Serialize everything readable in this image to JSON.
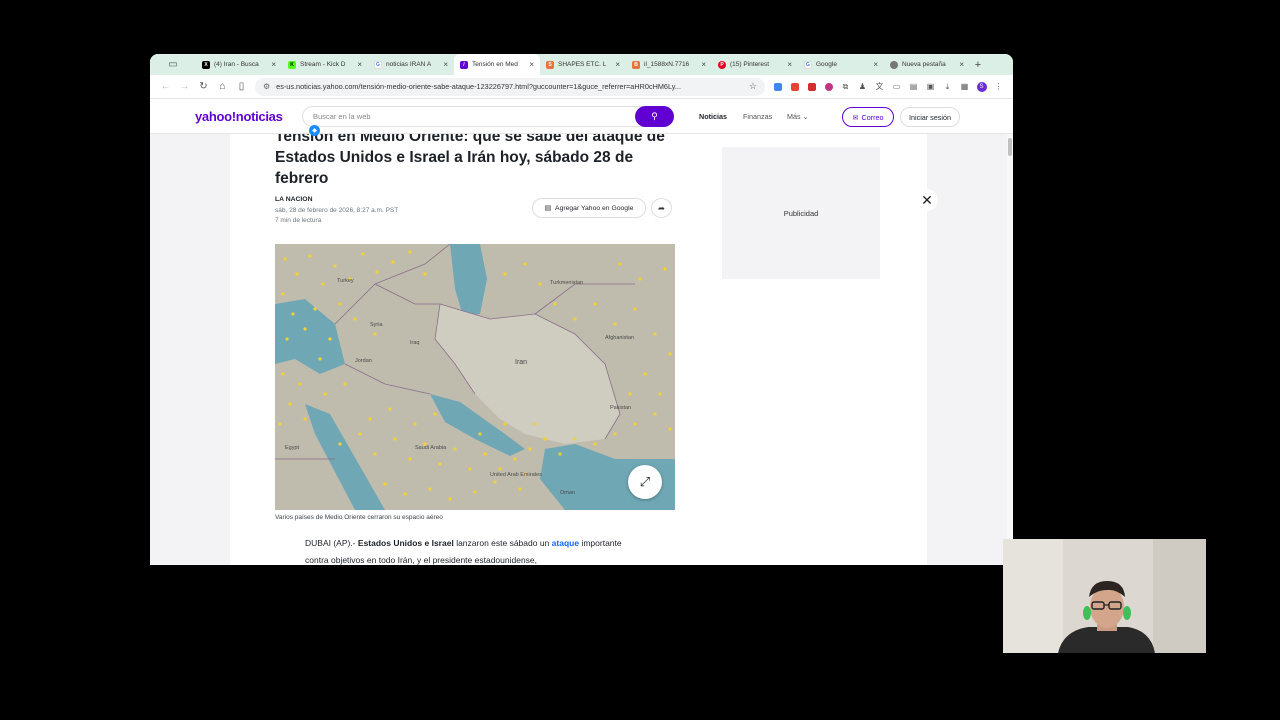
{
  "browser": {
    "tabs": [
      {
        "label": "(4) Iran - Busca",
        "favicon": "x-icon",
        "color": "#000000",
        "active": false
      },
      {
        "label": "Stream - Kick D",
        "favicon": "kick-icon",
        "color": "#53fc18",
        "active": false
      },
      {
        "label": "noticias IRAN A",
        "favicon": "google-icon",
        "color": "#4285f4",
        "active": false
      },
      {
        "label": "Tensión en Med",
        "favicon": "yahoo-icon",
        "color": "#6001d2",
        "active": true
      },
      {
        "label": "SHAPES ETC. L",
        "favicon": "shapes-icon",
        "color": "#e8743b",
        "active": false
      },
      {
        "label": "il_1588xN.7716",
        "favicon": "blogger-icon",
        "color": "#e8743b",
        "active": false
      },
      {
        "label": "(15) Pinterest",
        "favicon": "pinterest-icon",
        "color": "#e60023",
        "active": false
      },
      {
        "label": "Google",
        "favicon": "google-icon",
        "color": "#4285f4",
        "active": false
      },
      {
        "label": "Nueva pestaña",
        "favicon": "chrome-icon",
        "color": "#777777",
        "active": false
      }
    ],
    "url": "es-us.noticias.yahoo.com/tensión-medio-oriente-sabe-ataque-123226797.html?guccounter=1&guce_referrer=aHR0cHM6Ly..."
  },
  "yahoo": {
    "logo": "yahoo!noticias",
    "search_placeholder": "Buscar en la web",
    "nav": {
      "noticias": "Noticias",
      "finanzas": "Finanzas",
      "mas": "Más"
    },
    "mail_label": "Correo",
    "login_label": "Iniciar sesión"
  },
  "article": {
    "headline": "Tensión en Medio Oriente: qué se sabe del ataque de Estados Unidos e Israel a Irán hoy, sábado 28 de febrero",
    "source": "LA NACION",
    "date": "sáb, 28 de febrero de 2026, 8:27 a.m. PST",
    "read_time": "7 min de lectura",
    "google_button": "Agregar Yahoo en Google",
    "caption": "Varios países de Medio Oriente cerraron su espacio aéreo",
    "body_prefix": "DUBAI (AP).-",
    "body_bold": "Estados Unidos e Israel",
    "body_mid": "lanzaron este sábado un",
    "body_link": "ataque",
    "body_rest": "importante contra objetivos en todo Irán, y el presidente estadounidense,",
    "map_labels": {
      "turkey": "Turkey",
      "syria": "Syria",
      "iraq": "Iraq",
      "iran": "Iran",
      "turkmenistan": "Turkmenistan",
      "afghanistan": "Afghanistan",
      "pakistan": "Pakistan",
      "saudi": "Saudi Arabia",
      "uae": "United Arab Emirates",
      "oman": "Oman",
      "jordan": "Jordan",
      "egypt": "Egypt"
    }
  },
  "sidebar": {
    "ad_label": "Publicidad"
  }
}
